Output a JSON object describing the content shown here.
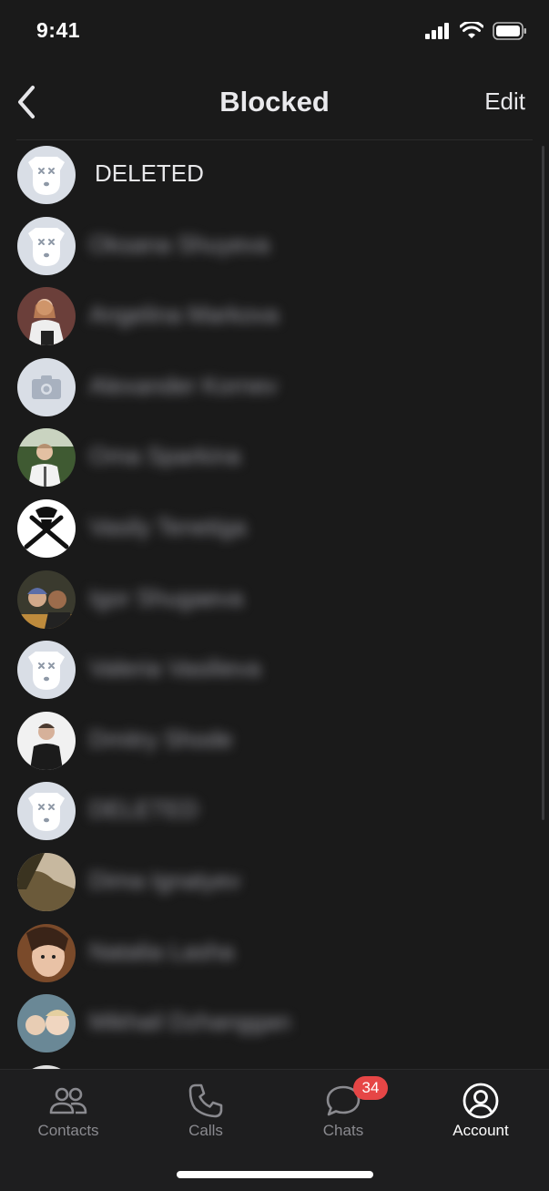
{
  "status": {
    "time": "9:41"
  },
  "nav": {
    "title": "Blocked",
    "edit_label": "Edit"
  },
  "contacts": [
    {
      "name": "DELETED",
      "avatar": "deleted-dog",
      "blurred": false
    },
    {
      "name": "Oksana Shuyeva",
      "avatar": "deleted-dog",
      "blurred": true
    },
    {
      "name": "Angelina Markova",
      "avatar": "photo-girl-white",
      "blurred": true
    },
    {
      "name": "Alexander Kornev",
      "avatar": "camera-placeholder",
      "blurred": true
    },
    {
      "name": "Oma Sparkina",
      "avatar": "photo-man-forest",
      "blurred": true
    },
    {
      "name": "Vasily Tenetiga",
      "avatar": "swords-logo",
      "blurred": true
    },
    {
      "name": "Igor Shugaeva",
      "avatar": "photo-two-people",
      "blurred": true
    },
    {
      "name": "Valeria Vasilieva",
      "avatar": "deleted-dog",
      "blurred": true
    },
    {
      "name": "Dmitry Shode",
      "avatar": "photo-man-dark",
      "blurred": true
    },
    {
      "name": "DELETED",
      "avatar": "deleted-dog",
      "blurred": true
    },
    {
      "name": "Dima Ignatyev",
      "avatar": "photo-landscape",
      "blurred": true
    },
    {
      "name": "Natalia Lasha",
      "avatar": "photo-face-closeup",
      "blurred": true
    },
    {
      "name": "Mikhail Dzhanggan",
      "avatar": "photo-kids",
      "blurred": true
    },
    {
      "name": "",
      "avatar": "photo-partial",
      "blurred": true
    }
  ],
  "tabs": [
    {
      "label": "Contacts",
      "icon": "contacts-icon",
      "active": false
    },
    {
      "label": "Calls",
      "icon": "phone-icon",
      "active": false
    },
    {
      "label": "Chats",
      "icon": "chat-bubble-icon",
      "active": false,
      "badge": "34"
    },
    {
      "label": "Account",
      "icon": "account-icon",
      "active": true
    }
  ],
  "colors": {
    "background": "#1a1a1a",
    "badge": "#e64646",
    "avatar_placeholder": "#d9dee6",
    "text": "#e8e8ea"
  }
}
